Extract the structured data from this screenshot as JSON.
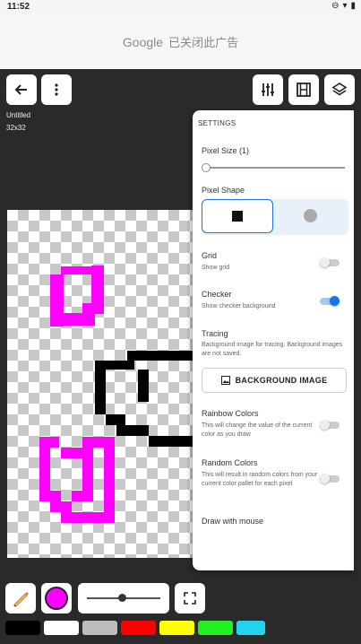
{
  "status": {
    "time": "11:52",
    "battery": ""
  },
  "ad": {
    "brand": "Google",
    "text": "已关闭此广告"
  },
  "file": {
    "name": "Untitled",
    "size": "32x32"
  },
  "settings": {
    "title": "SETTINGS",
    "pixel_size_label": "Pixel Size (1)",
    "pixel_size_value": 1,
    "pixel_shape_label": "Pixel Shape",
    "grid_label": "Grid",
    "grid_sub": "Show grid",
    "grid_on": false,
    "checker_label": "Checker",
    "checker_sub": "Show checker background",
    "checker_on": true,
    "tracing_label": "Tracing",
    "tracing_sub": "Background image for tracing. Background images are not saved.",
    "background_image_button": "BACKGROUND IMAGE",
    "rainbow_label": "Rainbow Colors",
    "rainbow_sub": "This will change the value of the current color as you draw",
    "rainbow_on": false,
    "random_label": "Random Colors",
    "random_sub": "This will result in random colors from your current color pallet for each pixel",
    "random_on": false,
    "mouse_label": "Draw with mouse"
  },
  "current_color": "#ff00ff",
  "brush_size_fraction": 0.5,
  "palette": [
    "#000000",
    "#ffffff",
    "#bdbdbd",
    "#ff0000",
    "#ffff00",
    "#22ee22",
    "#22d3ee"
  ]
}
